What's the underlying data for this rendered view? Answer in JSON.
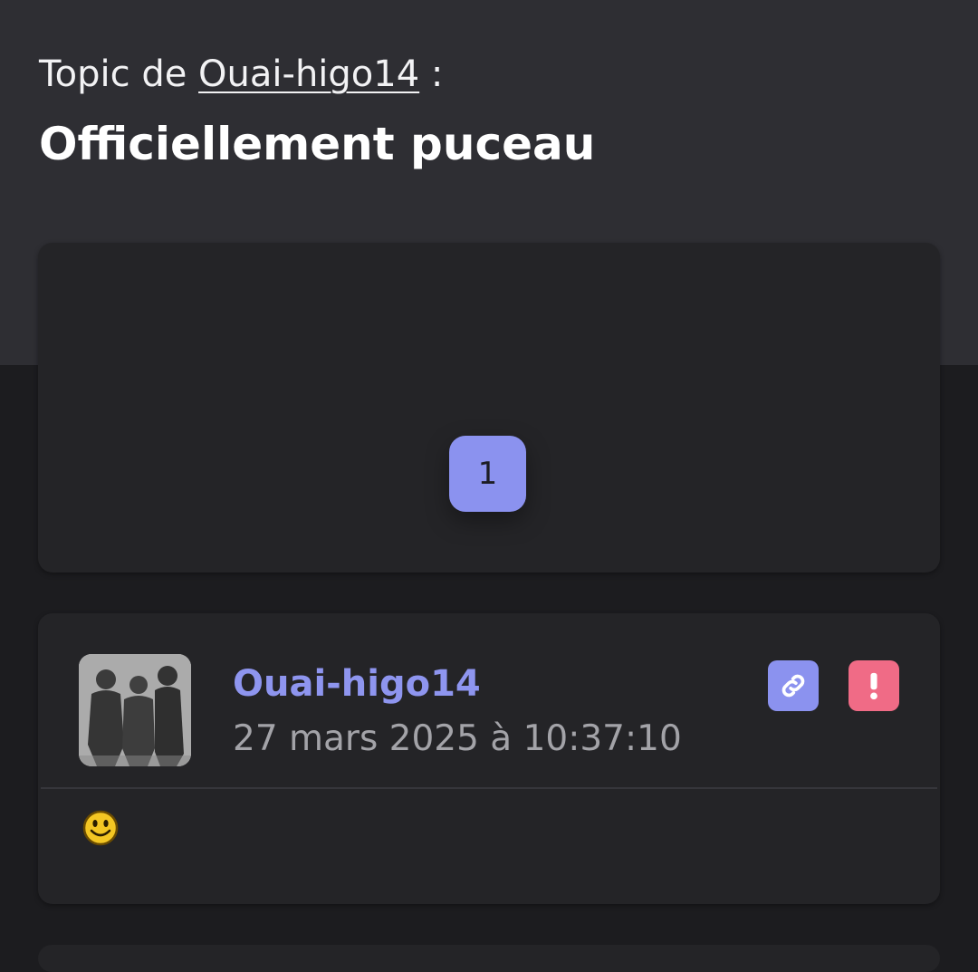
{
  "topic": {
    "prefix": "Topic de",
    "author": "Ouai-higo14",
    "suffix": " :",
    "title": "Officiellement puceau"
  },
  "pagination": {
    "current_page": "1"
  },
  "post": {
    "author": "Ouai-higo14",
    "date": "27 mars 2025 à 10:37:10",
    "link_icon": "link-icon",
    "report_icon": "exclamation-icon",
    "body_emoji": "smiley-icon"
  },
  "colors": {
    "accent": "#8b92ef",
    "report": "#f06b86",
    "header_bg": "#2e2e33",
    "card_bg": "#242427",
    "page_bg": "#1c1c1f"
  }
}
